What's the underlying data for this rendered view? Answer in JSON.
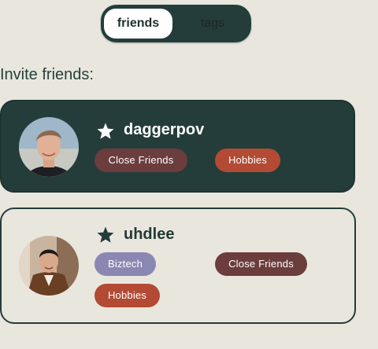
{
  "tabs": {
    "friends_label": "friends",
    "tags_label": "tags",
    "active": "friends"
  },
  "section_title": "Invite friends:",
  "friends": [
    {
      "username": "daggerpov",
      "favorite": true,
      "tags": [
        "Close Friends",
        "Hobbies"
      ]
    },
    {
      "username": "uhdlee",
      "favorite": true,
      "tags": [
        "Biztech",
        "Close Friends",
        "Hobbies"
      ]
    }
  ],
  "colors": {
    "background": "#e8e6dd",
    "dark_green": "#243d3a",
    "close_friends_tag": "#6b3d3d",
    "hobbies_tag": "#b24a34",
    "biztech_tag": "#8a87b2"
  },
  "icons": {
    "favorite": "star-icon"
  }
}
